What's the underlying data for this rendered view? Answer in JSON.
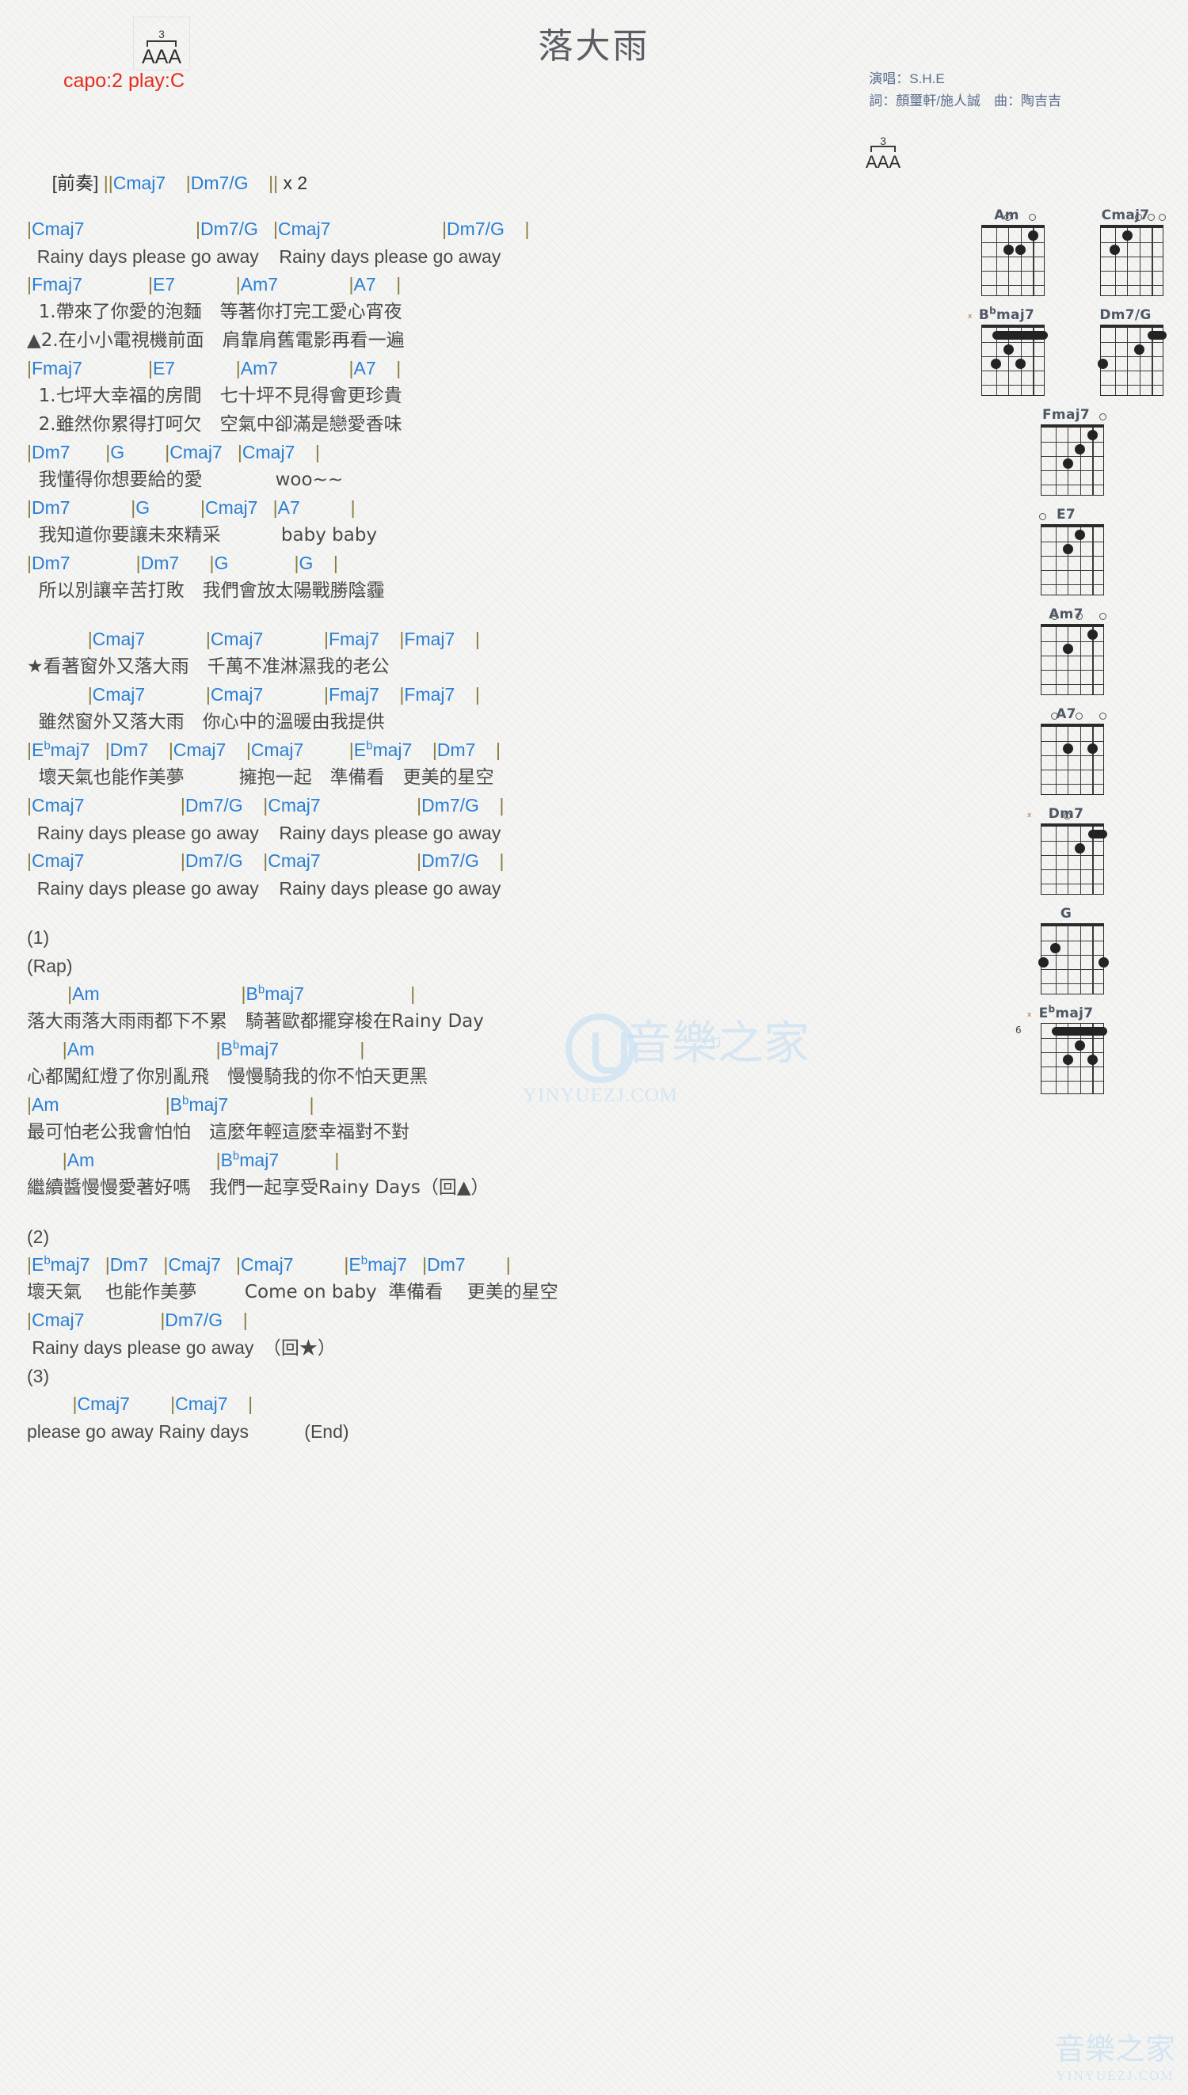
{
  "header": {
    "strum_pattern": {
      "number": "3",
      "letters": "AAA"
    },
    "title": "落大雨",
    "capo": "capo:2 play:C",
    "capo_color": "#e52b1a",
    "credits": {
      "singer": "演唱：S.H.E",
      "writers": "詞：顏璽軒/施人誠　曲：陶吉吉"
    },
    "intro": {
      "label": "[前奏]",
      "chords": "||Cmaj7    |Dm7/G    || x 2"
    }
  },
  "colors": {
    "chord": "#2a7fd4",
    "bar": "#8a7a3c",
    "lyric": "#4a4a4a",
    "title": "#5a5d63",
    "credits": "#5a6d8c",
    "watermark": "#bfdcf2"
  },
  "sections": [
    {
      "type": "chord",
      "text": "|Cmaj7                      |Dm7/G   |Cmaj7                      |Dm7/G    |"
    },
    {
      "type": "lyric",
      "lang": "en",
      "text": "  Rainy days please go away    Rainy days please go away"
    },
    {
      "type": "chord",
      "text": "|Fmaj7             |E7            |Am7              |A7    |"
    },
    {
      "type": "lyric",
      "text": "  1.帶來了你愛的泡麵　等著你打完工愛心宵夜"
    },
    {
      "type": "lyric",
      "text": "▲2.在小小電視機前面　肩靠肩舊電影再看一遍"
    },
    {
      "type": "chord",
      "text": "|Fmaj7             |E7            |Am7              |A7    |"
    },
    {
      "type": "lyric",
      "text": "  1.七坪大幸福的房間　七十坪不見得會更珍貴"
    },
    {
      "type": "lyric",
      "text": "  2.雖然你累得打呵欠　空氣中卻滿是戀愛香味"
    },
    {
      "type": "chord",
      "text": "|Dm7       |G        |Cmaj7   |Cmaj7    |"
    },
    {
      "type": "lyric",
      "text": "  我懂得你想要給的愛　　　　woo~~"
    },
    {
      "type": "chord",
      "text": "|Dm7            |G          |Cmaj7   |A7          |"
    },
    {
      "type": "lyric",
      "text": "  我知道你要讓未來精采　　　 baby baby"
    },
    {
      "type": "chord",
      "text": "|Dm7             |Dm7      |G             |G    |"
    },
    {
      "type": "lyric",
      "text": "  所以別讓辛苦打敗　我們會放太陽戰勝陰霾"
    },
    {
      "type": "blank"
    },
    {
      "type": "chord",
      "text": "            |Cmaj7            |Cmaj7            |Fmaj7    |Fmaj7    |"
    },
    {
      "type": "lyric",
      "text": "★看著窗外又落大雨　千萬不准淋濕我的老公"
    },
    {
      "type": "chord",
      "text": "            |Cmaj7            |Cmaj7            |Fmaj7    |Fmaj7    |"
    },
    {
      "type": "lyric",
      "text": "  雖然窗外又落大雨　你心中的溫暖由我提供"
    },
    {
      "type": "chord",
      "text": "|E^bmaj7   |Dm7    |Cmaj7    |Cmaj7         |E^bmaj7    |Dm7    |"
    },
    {
      "type": "lyric",
      "text": "  壞天氣也能作美夢　　　擁抱一起　準備看　更美的星空"
    },
    {
      "type": "chord",
      "text": "|Cmaj7                   |Dm7/G    |Cmaj7                   |Dm7/G    |"
    },
    {
      "type": "lyric",
      "lang": "en",
      "text": "  Rainy days please go away    Rainy days please go away"
    },
    {
      "type": "chord",
      "text": "|Cmaj7                   |Dm7/G    |Cmaj7                   |Dm7/G    |"
    },
    {
      "type": "lyric",
      "lang": "en",
      "text": "  Rainy days please go away    Rainy days please go away"
    },
    {
      "type": "blank"
    },
    {
      "type": "label",
      "text": "(1)"
    },
    {
      "type": "label",
      "text": "(Rap)"
    },
    {
      "type": "chord",
      "text": "        |Am                            |B^bmaj7                     |"
    },
    {
      "type": "lyric",
      "text": "落大雨落大雨雨都下不累　騎著歐都擺穿梭在Rainy Day"
    },
    {
      "type": "chord",
      "text": "       |Am                        |B^bmaj7                |"
    },
    {
      "type": "lyric",
      "text": "心都闖紅燈了你別亂飛　慢慢騎我的你不怕天更黑"
    },
    {
      "type": "chord",
      "text": "|Am                     |B^bmaj7                |"
    },
    {
      "type": "lyric",
      "text": "最可怕老公我會怕怕　這麼年輕這麼幸福對不對"
    },
    {
      "type": "chord",
      "text": "       |Am                        |B^bmaj7           |"
    },
    {
      "type": "lyric",
      "text": "繼續醬慢慢愛著好嗎　我們一起享受Rainy Days（回▲）"
    },
    {
      "type": "blank"
    },
    {
      "type": "label",
      "text": "(2)"
    },
    {
      "type": "chord",
      "text": "|E^bmaj7   |Dm7   |Cmaj7   |Cmaj7          |E^bmaj7   |Dm7        |"
    },
    {
      "type": "lyric",
      "text": "壞天氣　 也能作美夢　　  Come on baby  準備看　 更美的星空"
    },
    {
      "type": "chord",
      "text": "|Cmaj7               |Dm7/G    |"
    },
    {
      "type": "lyric",
      "lang": "en",
      "text": " Rainy days please go away　（回★）"
    },
    {
      "type": "label",
      "text": "(3)"
    },
    {
      "type": "chord",
      "text": "         |Cmaj7        |Cmaj7    |"
    },
    {
      "type": "lyric",
      "lang": "en",
      "text": "please go away Rainy days           (End)"
    }
  ],
  "chord_diagrams": [
    {
      "name": "Am",
      "flat": false,
      "open": [
        2,
        4
      ],
      "mute": false,
      "fret_label": "",
      "dots": [
        {
          "s": 2,
          "f": 2
        },
        {
          "s": 3,
          "f": 2
        },
        {
          "s": 4,
          "f": 1
        }
      ],
      "barre": null
    },
    {
      "name": "Cmaj7",
      "flat": false,
      "open": [
        3,
        4,
        5
      ],
      "mute": false,
      "fret_label": "",
      "dots": [
        {
          "s": 1,
          "f": 2
        },
        {
          "s": 2,
          "f": 1
        }
      ],
      "barre": null
    },
    {
      "name": "Bbmaj7",
      "flat": true,
      "flat_base": "B",
      "flat_rest": "maj7",
      "open": [],
      "mute": true,
      "fret_label": "",
      "dots": [
        {
          "s": 1,
          "f": 3
        },
        {
          "s": 3,
          "f": 3
        },
        {
          "s": 2,
          "f": 2
        }
      ],
      "barre": {
        "fret": 1,
        "from": 1,
        "to": 5
      }
    },
    {
      "name": "Dm7/G",
      "flat": false,
      "open": [],
      "mute": false,
      "fret_label": "",
      "dots": [
        {
          "s": 0,
          "f": 3
        },
        {
          "s": 3,
          "f": 2
        }
      ],
      "barre": {
        "fret": 1,
        "from": 4,
        "to": 5
      }
    },
    {
      "name": "Fmaj7",
      "flat": false,
      "open": [
        5
      ],
      "mute": false,
      "fret_label": "",
      "dots": [
        {
          "s": 4,
          "f": 1
        },
        {
          "s": 3,
          "f": 2
        },
        {
          "s": 2,
          "f": 3
        }
      ],
      "barre": null
    },
    {
      "name": "E7",
      "flat": false,
      "open": [
        0
      ],
      "mute": false,
      "fret_label": "",
      "dots": [
        {
          "s": 3,
          "f": 1
        },
        {
          "s": 2,
          "f": 2
        }
      ],
      "barre": null
    },
    {
      "name": "Am7",
      "flat": false,
      "open": [
        1,
        3,
        5
      ],
      "mute": false,
      "fret_label": "",
      "dots": [
        {
          "s": 4,
          "f": 1
        },
        {
          "s": 2,
          "f": 2
        }
      ],
      "barre": null
    },
    {
      "name": "A7",
      "flat": false,
      "open": [
        1,
        3,
        5
      ],
      "mute": false,
      "fret_label": "",
      "dots": [
        {
          "s": 2,
          "f": 2
        },
        {
          "s": 4,
          "f": 2
        }
      ],
      "barre": null
    },
    {
      "name": "Dm7",
      "flat": false,
      "open": [
        2
      ],
      "mute": true,
      "fret_label": "",
      "dots": [
        {
          "s": 3,
          "f": 2
        }
      ],
      "barre": {
        "fret": 1,
        "from": 4,
        "to": 5
      }
    },
    {
      "name": "G",
      "flat": false,
      "open": [],
      "mute": false,
      "fret_label": "",
      "dots": [
        {
          "s": 1,
          "f": 2
        },
        {
          "s": 0,
          "f": 3
        },
        {
          "s": 5,
          "f": 3
        }
      ],
      "barre": null
    },
    {
      "name": "Ebmaj7",
      "flat": true,
      "flat_base": "E",
      "flat_rest": "maj7",
      "open": [],
      "mute": true,
      "fret_label": "6",
      "dots": [
        {
          "s": 3,
          "f": 2
        },
        {
          "s": 2,
          "f": 3
        },
        {
          "s": 4,
          "f": 3
        }
      ],
      "barre": {
        "fret": 1,
        "from": 1,
        "to": 5
      }
    }
  ],
  "watermarks": {
    "center_text": "YINYUEZJ.COM",
    "center_cn": "音樂之家",
    "bottom_cn": "音樂之家",
    "bottom_url": "YINYUEZJ.COM"
  }
}
